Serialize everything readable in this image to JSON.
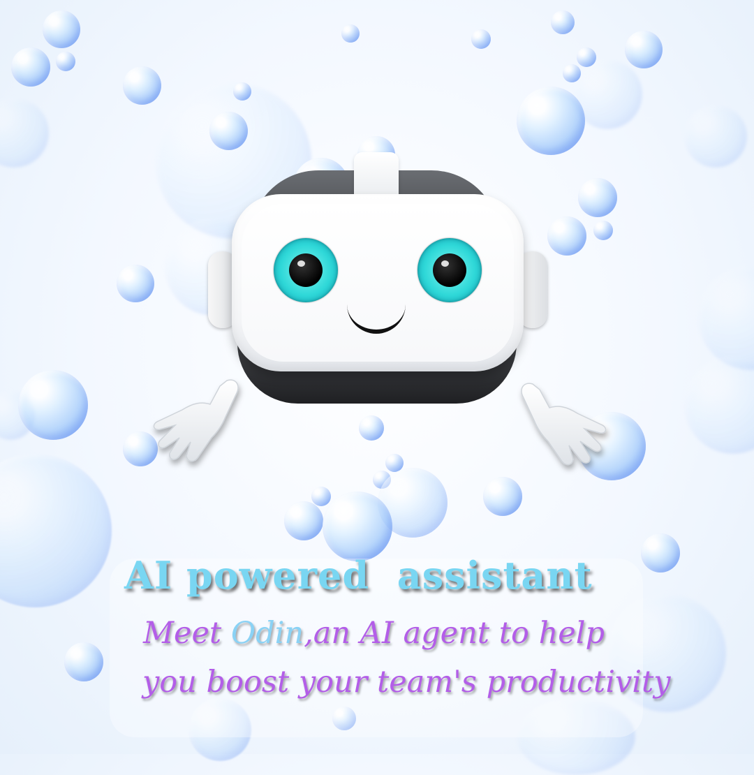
{
  "headline": "AI powered  assistant",
  "subtitle": {
    "line1_pre": "Meet ",
    "line1_name": "Odin",
    "line1_post": ",an AI agent to help",
    "line2": "you boost your team's productivity"
  },
  "colors": {
    "headline": "#79d6f2",
    "subtitle": "#b35ee8",
    "name_highlight": "#8ad2f5",
    "eye": "#2fd8d8",
    "bubble": "#9cc7f7"
  },
  "illustration": {
    "mascot": "vr-headset-robot-mascot",
    "background": "floating-bubbles"
  }
}
